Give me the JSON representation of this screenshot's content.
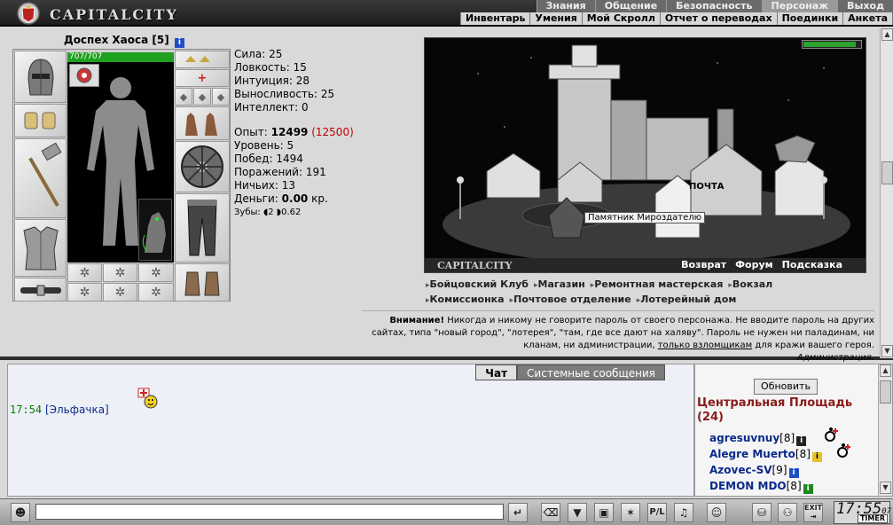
{
  "header": {
    "brand": "CAPITALCITY",
    "menu_top": [
      "Знания",
      "Общение",
      "Безопасность",
      "Персонаж",
      "Выход"
    ],
    "menu_top_active": "Персонаж",
    "menu_sub": [
      "Инвентарь",
      "Умения",
      "Мой Скролл",
      "Отчет о переводах",
      "Поединки",
      "Анкета"
    ]
  },
  "character": {
    "name": "Доспех Хаоса",
    "level_badge": "[5]",
    "hp": "707/707",
    "stats": [
      {
        "label": "Сила:",
        "value": "25"
      },
      {
        "label": "Ловкость:",
        "value": "15"
      },
      {
        "label": "Интуиция:",
        "value": "28"
      },
      {
        "label": "Выносливость:",
        "value": "25"
      },
      {
        "label": "Интеллект:",
        "value": "0"
      }
    ],
    "exp_label": "Опыт:",
    "exp_value": "12499",
    "exp_next": "(12500)",
    "level_label": "Уровень:",
    "level_value": "5",
    "wins_label": "Побед:",
    "wins_value": "1494",
    "losses_label": "Поражений:",
    "losses_value": "191",
    "draws_label": "Ничьих:",
    "draws_value": "13",
    "money_label": "Деньги:",
    "money_value": "0.00",
    "money_unit": "кр.",
    "teeth_label": "Зубы:",
    "teeth_a": "2",
    "teeth_b": "0.62"
  },
  "map": {
    "brand": "CAPITALCITY",
    "links": [
      "Возврат",
      "Форум",
      "Подсказка"
    ],
    "tooltip": "Памятник Мироздателю",
    "sign_text": "ПОЧТА",
    "meter_fraction": 0.92
  },
  "buildings": {
    "row1": [
      "Бойцовский Клуб",
      "Магазин",
      "Ремонтная мастерская",
      "Вокзал"
    ],
    "row2": [
      "Комиссионка",
      "Почтовое отделение",
      "Лотерейный дом"
    ]
  },
  "warning": {
    "title": "Внимание!",
    "text1": " Никогда и никому не говорите пароль от своего персонажа. Не вводите пароль на других сайтах, типа \"новый город\", \"лотерея\", \"там, где все дают на халяву\". Пароль не нужен ни паладинам, ни кланам, ни администрации, ",
    "link": "только взломщикам",
    "text2": " для кражи вашего героя.",
    "signature": "Администрация."
  },
  "chat": {
    "tabs": [
      "Чат",
      "Системные сообщения"
    ],
    "message_time": "17:54",
    "message_nick": "[Эльфачка]"
  },
  "players": {
    "refresh": "Обновить",
    "room_title": "Центральная Площадь",
    "room_count": "(24)",
    "list": [
      {
        "name": "agresuvnuy",
        "level": "[8]",
        "badge": "black"
      },
      {
        "name": "Alegre Muerto",
        "level": "[8]",
        "badge": "yellow"
      },
      {
        "name": "Azovec-SV",
        "level": "[9]",
        "badge": "blue"
      },
      {
        "name": "DEMON MDO",
        "level": "[8]",
        "badge": "green"
      }
    ]
  },
  "bottombar": {
    "input_value": "",
    "clock": "17:55",
    "clock_sec": "07",
    "timer_label": "TIMER",
    "exit_label": "EXIT",
    "pl_label": "P/L"
  }
}
